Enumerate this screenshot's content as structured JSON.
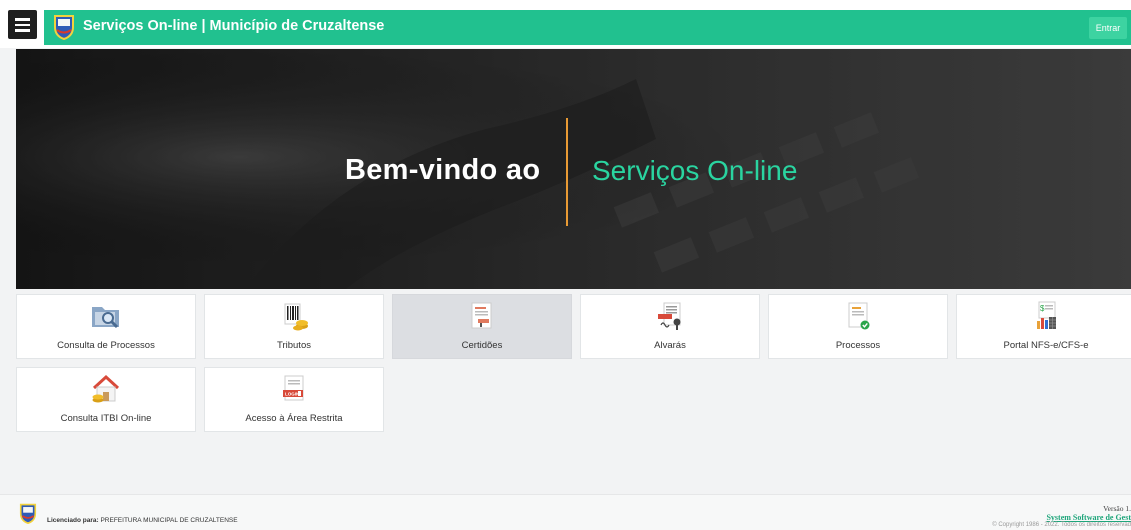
{
  "header": {
    "title": "Serviços On-line | Município de Cruzaltense",
    "login_label": "Entrar"
  },
  "hero": {
    "welcome": "Bem-vindo ao",
    "service": "Serviços On-line"
  },
  "tiles": [
    {
      "label": "Consulta de Processos",
      "icon": "folder-search-icon"
    },
    {
      "label": "Tributos",
      "icon": "barcode-coins-icon"
    },
    {
      "label": "Certidões",
      "icon": "certificate-document-icon"
    },
    {
      "label": "Alvarás",
      "icon": "permit-stamp-icon"
    },
    {
      "label": "Processos",
      "icon": "document-check-icon"
    },
    {
      "label": "Portal NFS-e/CFS-e",
      "icon": "invoice-chart-icon"
    },
    {
      "label": "Consulta ITBI On-line",
      "icon": "house-coins-icon"
    },
    {
      "label": "Acesso à Área Restrita",
      "icon": "login-document-icon"
    }
  ],
  "footer": {
    "licensed_label": "Licenciado para:",
    "licensed_value": "PREFEITURA MUNICIPAL DE CRUZALTENSE",
    "version": "Versão 1.",
    "company": "System Software de Gest",
    "copyright": "© Copyright 1986 - 2022. Todos os direitos reservad"
  },
  "colors": {
    "accent": "#21c18f",
    "hero_text_accent": "#2ad4a0",
    "divider": "#e89a34"
  }
}
